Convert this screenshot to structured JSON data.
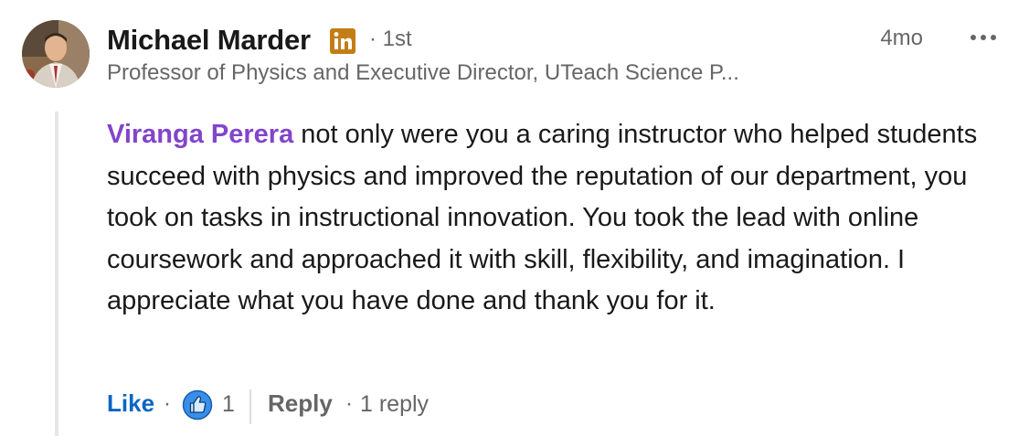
{
  "author": {
    "name": "Michael Marder",
    "connection_degree": "1st",
    "headline": "Professor of Physics and Executive Director, UTeach Science P...",
    "badge_icon": "linkedin-premium-icon",
    "badge_color": "#c37d16"
  },
  "meta": {
    "timestamp": "4mo",
    "more_label": "•••"
  },
  "comment": {
    "mention": "Viranga Perera",
    "text": " not only were you a caring instructor who helped students succeed with physics and improved the reputation of our department, you took on tasks in instructional innovation. You took the lead with online coursework and approached it with skill, flexibility, and imagination. I appreciate what you have done and thank you for it.",
    "mention_color": "#8344cc"
  },
  "actions": {
    "like_label": "Like",
    "separator": "·",
    "reaction_icon": "like-reaction-icon",
    "reaction_count": "1",
    "reply_label": "Reply",
    "reply_count": "1 reply",
    "like_color": "#0a66c2"
  }
}
